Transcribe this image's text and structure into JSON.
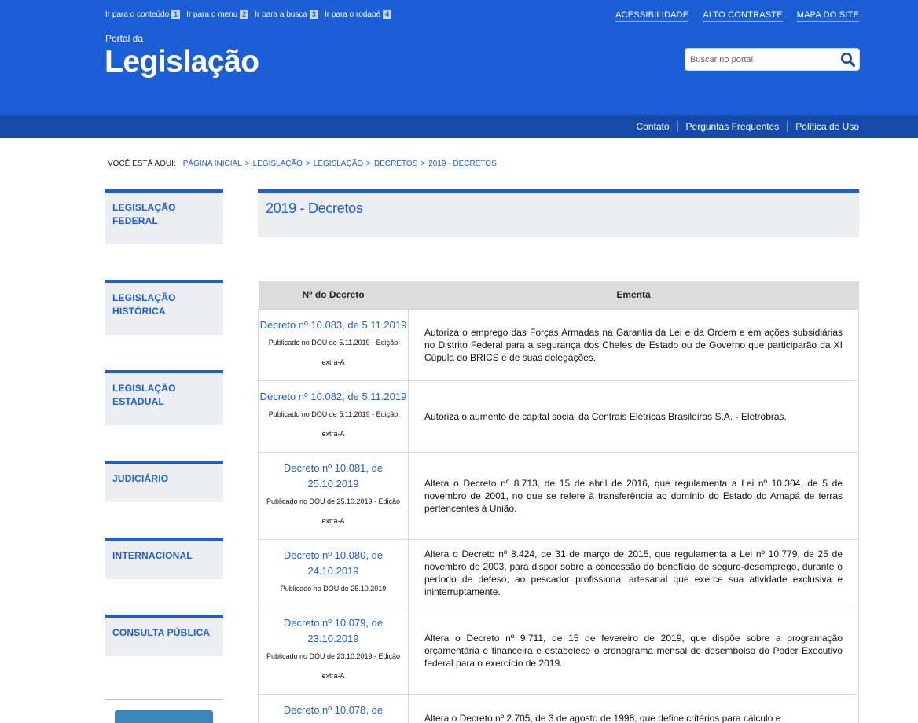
{
  "skip_links": [
    {
      "label": "Ir para o conteúdo",
      "num": "1"
    },
    {
      "label": "Ir para o menu",
      "num": "2"
    },
    {
      "label": "Ir para a busca",
      "num": "3"
    },
    {
      "label": "Ir para o rodapé",
      "num": "4"
    }
  ],
  "top_links": [
    "ACESSIBILIDADE",
    "ALTO CONTRASTE",
    "MAPA DO SITE"
  ],
  "portal": {
    "pre": "Portal da",
    "title": "Legislação"
  },
  "search": {
    "placeholder": "Buscar no portal",
    "icon": "search-icon"
  },
  "subbar_links": [
    "Contato",
    "Perguntas Frequentes",
    "Política de Uso"
  ],
  "breadcrumb": {
    "label": "VOCÊ ESTÁ AQUI:",
    "items": [
      "PÁGINA INICIAL",
      "LEGISLAÇÃO",
      "LEGISLAÇÃO",
      "DECRETOS",
      "2019 - DECRETOS"
    ],
    "sep": ">"
  },
  "sidebar": {
    "items": [
      {
        "line1": "LEGISLAÇÃO",
        "line2": "FEDERAL"
      },
      {
        "line1": "LEGISLAÇÃO",
        "line2": "HISTÓRICA"
      },
      {
        "line1": "LEGISLAÇÃO",
        "line2": "ESTADUAL"
      },
      {
        "line1": "JUDICIÁRIO",
        "line2": ""
      },
      {
        "line1": "INTERNACIONAL",
        "line2": ""
      },
      {
        "line1": "CONSULTA PÚBLICA",
        "line2": ""
      }
    ]
  },
  "page_title": "2019 - Decretos",
  "table": {
    "headers": [
      "Nº do Decreto",
      "Ementa"
    ],
    "rows": [
      {
        "decree_l1": "Decreto nº 10.083, de 5.11.2019",
        "decree_l2": "",
        "pub_l1": "Publicado no DOU de 5.11.2019 - Edição",
        "pub_l2": "extra-A",
        "ementa": "Autoriza o emprego das Forças Armadas na Garantia da Lei e da Ordem e em ações subsidiárias no Distrito Federal para a segurança dos Chefes de Estado ou de Governo que participarão da XI Cúpula do BRICS e de suas delegações."
      },
      {
        "decree_l1": "Decreto nº 10.082, de 5.11.2019",
        "decree_l2": "",
        "pub_l1": "Publicado no DOU de 5.11.2019 - Edição",
        "pub_l2": "extra-A",
        "ementa": "Autoriza o aumento de capital social da Centrais Elétricas Brasileiras S.A. - Eletrobras."
      },
      {
        "decree_l1": "Decreto nº 10.081, de",
        "decree_l2": "25.10.2019",
        "pub_l1": "Publicado no DOU de 25.10.2019 - Edição",
        "pub_l2": "extra-A",
        "ementa": "Altera o Decreto nº 8.713, de 15 de abril de 2016, que regulamenta a Lei nº 10.304, de 5 de novembro de 2001, no que se refere à transferência ao domínio do Estado do Amapá de terras pertencentes à União."
      },
      {
        "decree_l1": "Decreto nº 10.080, de",
        "decree_l2": "24.10.2019",
        "pub_l1": "Publicado no DOU de 25.10.2019",
        "pub_l2": "",
        "ementa": "Altera o Decreto nº 8.424, de 31 de março de 2015, que regulamenta a Lei nº 10.779, de 25 de novembro de 2003, para dispor sobre a concessão do benefício de seguro-desemprego, durante o período de defeso, ao pescador profissional artesanal que exerce sua atividade exclusiva e ininterruptamente."
      },
      {
        "decree_l1": "Decreto nº 10.079, de",
        "decree_l2": "23.10.2019",
        "pub_l1": "Publicado no DOU de 23.10.2019 - Edição",
        "pub_l2": "extra-A",
        "ementa": "Altera o Decreto nº 9.711, de 15 de fevereiro de 2019, que dispõe sobre a programação orçamentária e financeira e estabelece o cronograma mensal de desembolso do Poder Executivo federal para o exercício de 2019."
      },
      {
        "decree_l1": "Decreto nº 10.078, de",
        "decree_l2": "",
        "pub_l1": "",
        "pub_l2": "",
        "ementa": "Altera o Decreto nº 2.705, de 3 de agosto de 1998, que define critérios para cálculo e"
      }
    ]
  },
  "colors": {
    "brand_blue": "#1c5ed6",
    "subbar_blue": "#154ba8",
    "panel_gray": "#eceef1",
    "header_gray": "#dcdcdc"
  }
}
